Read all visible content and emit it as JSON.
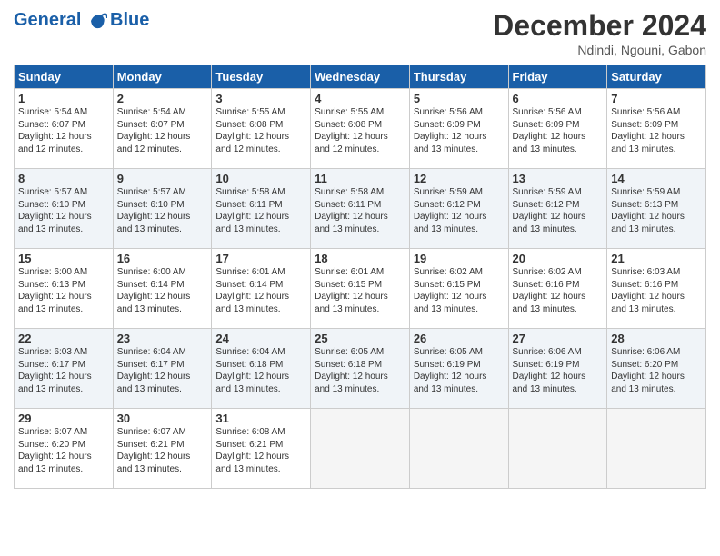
{
  "header": {
    "logo_line1": "General",
    "logo_line2": "Blue",
    "month": "December 2024",
    "location": "Ndindi, Ngouni, Gabon"
  },
  "days_of_week": [
    "Sunday",
    "Monday",
    "Tuesday",
    "Wednesday",
    "Thursday",
    "Friday",
    "Saturday"
  ],
  "weeks": [
    [
      {
        "day": 1,
        "sunrise": "5:54 AM",
        "sunset": "6:07 PM",
        "daylight": "12 hours and 12 minutes."
      },
      {
        "day": 2,
        "sunrise": "5:54 AM",
        "sunset": "6:07 PM",
        "daylight": "12 hours and 12 minutes."
      },
      {
        "day": 3,
        "sunrise": "5:55 AM",
        "sunset": "6:08 PM",
        "daylight": "12 hours and 12 minutes."
      },
      {
        "day": 4,
        "sunrise": "5:55 AM",
        "sunset": "6:08 PM",
        "daylight": "12 hours and 12 minutes."
      },
      {
        "day": 5,
        "sunrise": "5:56 AM",
        "sunset": "6:09 PM",
        "daylight": "12 hours and 13 minutes."
      },
      {
        "day": 6,
        "sunrise": "5:56 AM",
        "sunset": "6:09 PM",
        "daylight": "12 hours and 13 minutes."
      },
      {
        "day": 7,
        "sunrise": "5:56 AM",
        "sunset": "6:09 PM",
        "daylight": "12 hours and 13 minutes."
      }
    ],
    [
      {
        "day": 8,
        "sunrise": "5:57 AM",
        "sunset": "6:10 PM",
        "daylight": "12 hours and 13 minutes."
      },
      {
        "day": 9,
        "sunrise": "5:57 AM",
        "sunset": "6:10 PM",
        "daylight": "12 hours and 13 minutes."
      },
      {
        "day": 10,
        "sunrise": "5:58 AM",
        "sunset": "6:11 PM",
        "daylight": "12 hours and 13 minutes."
      },
      {
        "day": 11,
        "sunrise": "5:58 AM",
        "sunset": "6:11 PM",
        "daylight": "12 hours and 13 minutes."
      },
      {
        "day": 12,
        "sunrise": "5:59 AM",
        "sunset": "6:12 PM",
        "daylight": "12 hours and 13 minutes."
      },
      {
        "day": 13,
        "sunrise": "5:59 AM",
        "sunset": "6:12 PM",
        "daylight": "12 hours and 13 minutes."
      },
      {
        "day": 14,
        "sunrise": "5:59 AM",
        "sunset": "6:13 PM",
        "daylight": "12 hours and 13 minutes."
      }
    ],
    [
      {
        "day": 15,
        "sunrise": "6:00 AM",
        "sunset": "6:13 PM",
        "daylight": "12 hours and 13 minutes."
      },
      {
        "day": 16,
        "sunrise": "6:00 AM",
        "sunset": "6:14 PM",
        "daylight": "12 hours and 13 minutes."
      },
      {
        "day": 17,
        "sunrise": "6:01 AM",
        "sunset": "6:14 PM",
        "daylight": "12 hours and 13 minutes."
      },
      {
        "day": 18,
        "sunrise": "6:01 AM",
        "sunset": "6:15 PM",
        "daylight": "12 hours and 13 minutes."
      },
      {
        "day": 19,
        "sunrise": "6:02 AM",
        "sunset": "6:15 PM",
        "daylight": "12 hours and 13 minutes."
      },
      {
        "day": 20,
        "sunrise": "6:02 AM",
        "sunset": "6:16 PM",
        "daylight": "12 hours and 13 minutes."
      },
      {
        "day": 21,
        "sunrise": "6:03 AM",
        "sunset": "6:16 PM",
        "daylight": "12 hours and 13 minutes."
      }
    ],
    [
      {
        "day": 22,
        "sunrise": "6:03 AM",
        "sunset": "6:17 PM",
        "daylight": "12 hours and 13 minutes."
      },
      {
        "day": 23,
        "sunrise": "6:04 AM",
        "sunset": "6:17 PM",
        "daylight": "12 hours and 13 minutes."
      },
      {
        "day": 24,
        "sunrise": "6:04 AM",
        "sunset": "6:18 PM",
        "daylight": "12 hours and 13 minutes."
      },
      {
        "day": 25,
        "sunrise": "6:05 AM",
        "sunset": "6:18 PM",
        "daylight": "12 hours and 13 minutes."
      },
      {
        "day": 26,
        "sunrise": "6:05 AM",
        "sunset": "6:19 PM",
        "daylight": "12 hours and 13 minutes."
      },
      {
        "day": 27,
        "sunrise": "6:06 AM",
        "sunset": "6:19 PM",
        "daylight": "12 hours and 13 minutes."
      },
      {
        "day": 28,
        "sunrise": "6:06 AM",
        "sunset": "6:20 PM",
        "daylight": "12 hours and 13 minutes."
      }
    ],
    [
      {
        "day": 29,
        "sunrise": "6:07 AM",
        "sunset": "6:20 PM",
        "daylight": "12 hours and 13 minutes."
      },
      {
        "day": 30,
        "sunrise": "6:07 AM",
        "sunset": "6:21 PM",
        "daylight": "12 hours and 13 minutes."
      },
      {
        "day": 31,
        "sunrise": "6:08 AM",
        "sunset": "6:21 PM",
        "daylight": "12 hours and 13 minutes."
      },
      null,
      null,
      null,
      null
    ]
  ]
}
